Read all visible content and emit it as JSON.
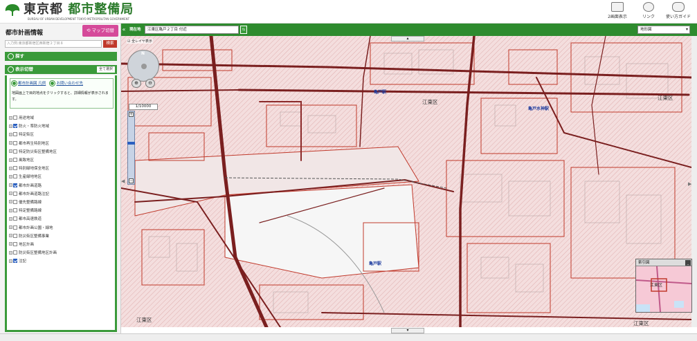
{
  "header": {
    "logo_main": "東京都",
    "logo_sub": "都市整備局",
    "logo_en": "BUREAU OF URBAN DEVELOPMENT TOKYO METROPOLITAN GOVERNMENT",
    "buttons": [
      {
        "label": "2画面表示",
        "icon": "dual-screen-icon"
      },
      {
        "label": "リンク",
        "icon": "link-icon"
      },
      {
        "label": "使い方ガイド",
        "icon": "guide-icon"
      }
    ]
  },
  "left": {
    "title": "都市計画情報",
    "map_switch": "マップ切替",
    "search_placeholder": "入力例:東京都新宿区西新宿２丁目８",
    "search_button": "検索",
    "find_bar": "探す",
    "display_bar": "表示切替",
    "select_all": "全て選択",
    "link_legend": "都市計画図 凡例",
    "link_contact": "お問い合わせ先",
    "info_text": "地図画上で目的地点をクリックすると、詳細情報が表示されます。",
    "layers": [
      {
        "label": "用途地域",
        "checked": false
      },
      {
        "label": "防火・準防火地域",
        "checked": true
      },
      {
        "label": "特定街区",
        "checked": false
      },
      {
        "label": "都市再生特別地区",
        "checked": false
      },
      {
        "label": "特定防災街区整備地区",
        "checked": false
      },
      {
        "label": "風致地区",
        "checked": false
      },
      {
        "label": "特別緑地保全地区",
        "checked": false
      },
      {
        "label": "生産緑地地区",
        "checked": false
      },
      {
        "label": "都市計画道路",
        "checked": true
      },
      {
        "label": "都市計画道路注記",
        "checked": false
      },
      {
        "label": "優先整備路線",
        "checked": false
      },
      {
        "label": "特定整備路線",
        "checked": false
      },
      {
        "label": "都市高速鉄道",
        "checked": false
      },
      {
        "label": "都市計画公園・緑地",
        "checked": false
      },
      {
        "label": "防災街区整備事業",
        "checked": false
      },
      {
        "label": "地区計画",
        "checked": false
      },
      {
        "label": "防災街区整備地区計画",
        "checked": false
      },
      {
        "label": "注記",
        "checked": true
      }
    ]
  },
  "mapbar": {
    "collapse": "«",
    "current_label": "現在地",
    "address": "江東区亀戸２丁目 付近",
    "map_type": "地形図"
  },
  "map": {
    "display_all": "全レイヤ表示",
    "scale": "1/10000",
    "labels": [
      {
        "text": "江東区",
        "kind": "ward"
      },
      {
        "text": "江東区",
        "kind": "ward"
      },
      {
        "text": "江東区",
        "kind": "ward"
      },
      {
        "text": "江東区",
        "kind": "ward"
      },
      {
        "text": "亀戸駅",
        "kind": "station"
      },
      {
        "text": "亀戸水神駅",
        "kind": "station"
      },
      {
        "text": "亀戸駅",
        "kind": "station"
      }
    ],
    "overview_title": "索引図",
    "overview_label": "江東区"
  },
  "colors": {
    "primary_green": "#2e8b2e",
    "boundary_red": "#c0392b",
    "switch_pink": "#d54a9a"
  }
}
